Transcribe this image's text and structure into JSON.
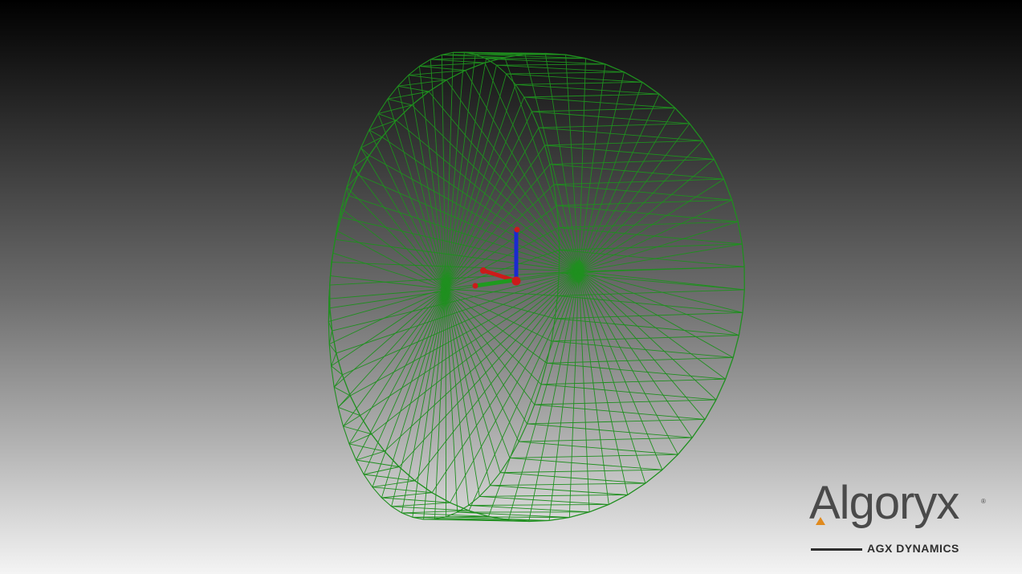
{
  "viewer": {
    "background_top": "#000000",
    "background_bottom": "#f4f4f4",
    "mesh_color": "#1f8f1f",
    "render_mode": "wireframe",
    "object": "hollow cylinder",
    "axis_colors": {
      "x": "#cc1a1a",
      "y": "#1f9a1f",
      "z": "#1a2ad0"
    }
  },
  "logo": {
    "wordmark": "Algoryx",
    "registered": "®",
    "tagline": "AGX DYNAMICS",
    "accent_color": "#e08a1e"
  }
}
